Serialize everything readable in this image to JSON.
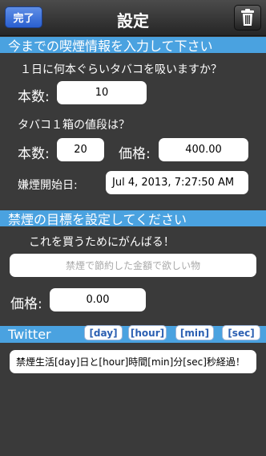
{
  "navbar": {
    "done_label": "完了",
    "title": "設定",
    "trash_icon": "trash-icon"
  },
  "section1": {
    "header": "今までの喫煙情報を入力して下さい",
    "q_daily": "１日に何本ぐらいタバコを吸いますか？",
    "count_label": "本数:",
    "daily_count": "10",
    "q_price": "タバコ１箱の値段は？",
    "pack_count_label": "本数:",
    "pack_count": "20",
    "price_label": "価格:",
    "price": "400.00",
    "quit_date_label": "嫌煙開始日:",
    "quit_date": "Jul 4, 2013, 7:27:50 AM"
  },
  "section2": {
    "header": "禁煙の目標を設定してください",
    "prompt": "これを買うためにがんばる！",
    "goal_placeholder": "禁煙で節約した金額で欲しい物",
    "price_label": "価格:",
    "goal_price": "0.00"
  },
  "twitter": {
    "header": "Twitter",
    "buttons": [
      "[day]",
      "[hour]",
      "[min]",
      "[sec]"
    ],
    "message": "禁煙生活[day]日と[hour]時間[min]分[sec]秒経過！"
  },
  "colors": {
    "section_bar": "#4aa2e0",
    "background": "#3a3a3a",
    "done_button": "#2a5fd0"
  }
}
